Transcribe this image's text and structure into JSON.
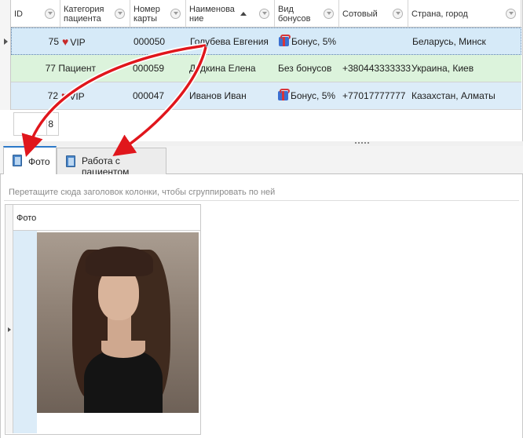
{
  "grid": {
    "columns": [
      {
        "key": "id",
        "label": "ID"
      },
      {
        "key": "category",
        "label": "Категория пациента"
      },
      {
        "key": "card",
        "label": "Номер карты"
      },
      {
        "key": "name",
        "label": "Наименование"
      },
      {
        "key": "bonus",
        "label": "Вид бонусов"
      },
      {
        "key": "phone",
        "label": "Сотовый"
      },
      {
        "key": "country",
        "label": "Страна, город"
      }
    ],
    "rows": [
      {
        "id": "75",
        "category": "VIP",
        "card": "000050",
        "name": "Голубева Евгения",
        "bonus": "Бонус, 5%",
        "phone": "",
        "country": "Беларусь, Минск"
      },
      {
        "id": "77",
        "category": "Пациент",
        "card": "000059",
        "name": "Дудкина Елена",
        "bonus": "Без бонусов",
        "phone": "+380443333333",
        "country": "Украина, Киев"
      },
      {
        "id": "72",
        "category": "VIP",
        "card": "000047",
        "name": "Иванов Иван",
        "bonus": "Бонус, 5%",
        "phone": "+77017777777",
        "country": "Казахстан, Алматы"
      }
    ],
    "record_count": "8",
    "icons": {
      "vip": "heart-icon",
      "bonus": "gift-icon",
      "filter": "filter-icon",
      "sort": "sort-asc-icon"
    },
    "colors": {
      "selected_row": "#d6eaf8",
      "green_row": "#dcf3dc",
      "blue_row": "#dcecf8",
      "arrow": "#e0161c"
    }
  },
  "tabs": [
    {
      "label": "Фото",
      "active": true
    },
    {
      "label": "Работа с пациентом",
      "active": false
    }
  ],
  "panel": {
    "group_hint": "Перетащите сюда заголовок колонки, чтобы сгруппировать по ней",
    "photo_column": "Фото"
  }
}
